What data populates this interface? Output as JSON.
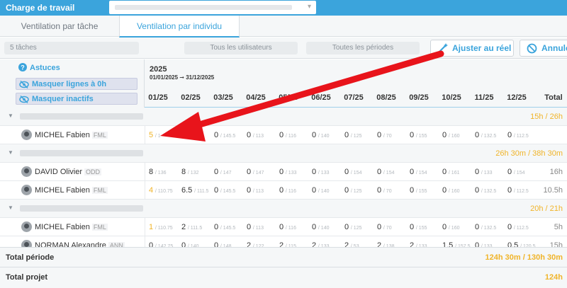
{
  "header": {
    "title": "Charge de travail",
    "selector_value": ""
  },
  "tabs": [
    {
      "label": "Ventilation par tâche"
    },
    {
      "label": "Ventilation par individu"
    }
  ],
  "filters": {
    "tasks": "5 tâches",
    "users": "Tous les utilisateurs",
    "periods": "Toutes les périodes",
    "adjust": "Ajuster au réel",
    "cancel": "Annuler"
  },
  "sidebar": {
    "astuces": "Astuces",
    "hide_zero": "Masquer lignes à 0h",
    "hide_inactive": "Masquer inactifs"
  },
  "timeline": {
    "year": "2025",
    "range": "01/01/2025 ➞ 31/12/2025",
    "months": [
      "01/25",
      "02/25",
      "03/25",
      "04/25",
      "05/25",
      "06/25",
      "07/25",
      "08/25",
      "09/25",
      "10/25",
      "11/25",
      "12/25"
    ],
    "total_label": "Total"
  },
  "groups": [
    {
      "total": "15h / 26h",
      "users": [
        {
          "name": "MICHEL Fabien",
          "code": "FML",
          "total": "",
          "cells": [
            [
              "5",
              "/ 1"
            ],
            [
              "",
              "/ 111.5"
            ],
            [
              "0",
              "/ 145.5"
            ],
            [
              "0",
              "/ 113"
            ],
            [
              "0",
              "/ 116"
            ],
            [
              "0",
              "/ 140"
            ],
            [
              "0",
              "/ 125"
            ],
            [
              "0",
              "/ 70"
            ],
            [
              "0",
              "/ 155"
            ],
            [
              "0",
              "/ 160"
            ],
            [
              "0",
              "/ 132.5"
            ],
            [
              "0",
              "/ 112.5"
            ]
          ],
          "highlight": [
            0
          ]
        }
      ]
    },
    {
      "total": "26h 30m / 38h 30m",
      "users": [
        {
          "name": "DAVID Olivier",
          "code": "ODD",
          "total": "16h",
          "cells": [
            [
              "8",
              "/ 136"
            ],
            [
              "8",
              "/ 132"
            ],
            [
              "0",
              "/ 147"
            ],
            [
              "0",
              "/ 147"
            ],
            [
              "0",
              "/ 133"
            ],
            [
              "0",
              "/ 133"
            ],
            [
              "0",
              "/ 154"
            ],
            [
              "0",
              "/ 154"
            ],
            [
              "0",
              "/ 154"
            ],
            [
              "0",
              "/ 161"
            ],
            [
              "0",
              "/ 133"
            ],
            [
              "0",
              "/ 154"
            ]
          ],
          "highlight": []
        },
        {
          "name": "MICHEL Fabien",
          "code": "FML",
          "total": "10.5h",
          "cells": [
            [
              "4",
              "/ 110.75"
            ],
            [
              "6.5",
              "/ 111.5"
            ],
            [
              "0",
              "/ 145.5"
            ],
            [
              "0",
              "/ 113"
            ],
            [
              "0",
              "/ 116"
            ],
            [
              "0",
              "/ 140"
            ],
            [
              "0",
              "/ 125"
            ],
            [
              "0",
              "/ 70"
            ],
            [
              "0",
              "/ 155"
            ],
            [
              "0",
              "/ 160"
            ],
            [
              "0",
              "/ 132.5"
            ],
            [
              "0",
              "/ 112.5"
            ]
          ],
          "highlight": [
            0
          ]
        }
      ]
    },
    {
      "total": "20h / 21h",
      "users": [
        {
          "name": "MICHEL Fabien",
          "code": "FML",
          "total": "5h",
          "cells": [
            [
              "1",
              "/ 110.75"
            ],
            [
              "2",
              "/ 111.5"
            ],
            [
              "0",
              "/ 145.5"
            ],
            [
              "0",
              "/ 113"
            ],
            [
              "0",
              "/ 116"
            ],
            [
              "0",
              "/ 140"
            ],
            [
              "0",
              "/ 125"
            ],
            [
              "0",
              "/ 70"
            ],
            [
              "0",
              "/ 155"
            ],
            [
              "0",
              "/ 160"
            ],
            [
              "0",
              "/ 132.5"
            ],
            [
              "0",
              "/ 112.5"
            ]
          ],
          "highlight": [
            0
          ]
        },
        {
          "name": "NORMAN Alexandre",
          "code": "ANN",
          "total": "15h",
          "cells": [
            [
              "0",
              "/ 142.75"
            ],
            [
              "0",
              "/ 140"
            ],
            [
              "0",
              "/ 148"
            ],
            [
              "2",
              "/ 122"
            ],
            [
              "2",
              "/ 115"
            ],
            [
              "2",
              "/ 133"
            ],
            [
              "2",
              "/ 53"
            ],
            [
              "2",
              "/ 138"
            ],
            [
              "2",
              "/ 133"
            ],
            [
              "1.5",
              "/ 157.5"
            ],
            [
              "0",
              "/ 133"
            ],
            [
              "0.5",
              "/ 120.5"
            ]
          ],
          "highlight": []
        }
      ]
    }
  ],
  "footer": {
    "period_label": "Total période",
    "period_value": "124h 30m / 130h 30m",
    "project_label": "Total projet",
    "project_value": "124h"
  },
  "colors": {
    "accent": "#3ba4dc",
    "highlight": "#f0b429",
    "arrow": "#e8141b"
  }
}
